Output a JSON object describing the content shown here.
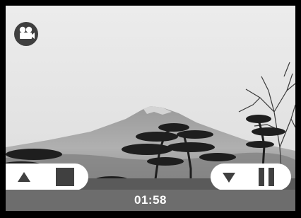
{
  "playback": {
    "mode_icon": "movie-camera-icon",
    "elapsed_time": "01:58"
  },
  "controls": {
    "left_group": [
      "rewind-up-icon",
      "stop-icon"
    ],
    "right_group": [
      "forward-down-icon",
      "pause-icon"
    ]
  },
  "colors": {
    "frame": "#000000",
    "time_bar": "#6d6d6d",
    "icon": "#404040",
    "pill": "#ffffff"
  }
}
